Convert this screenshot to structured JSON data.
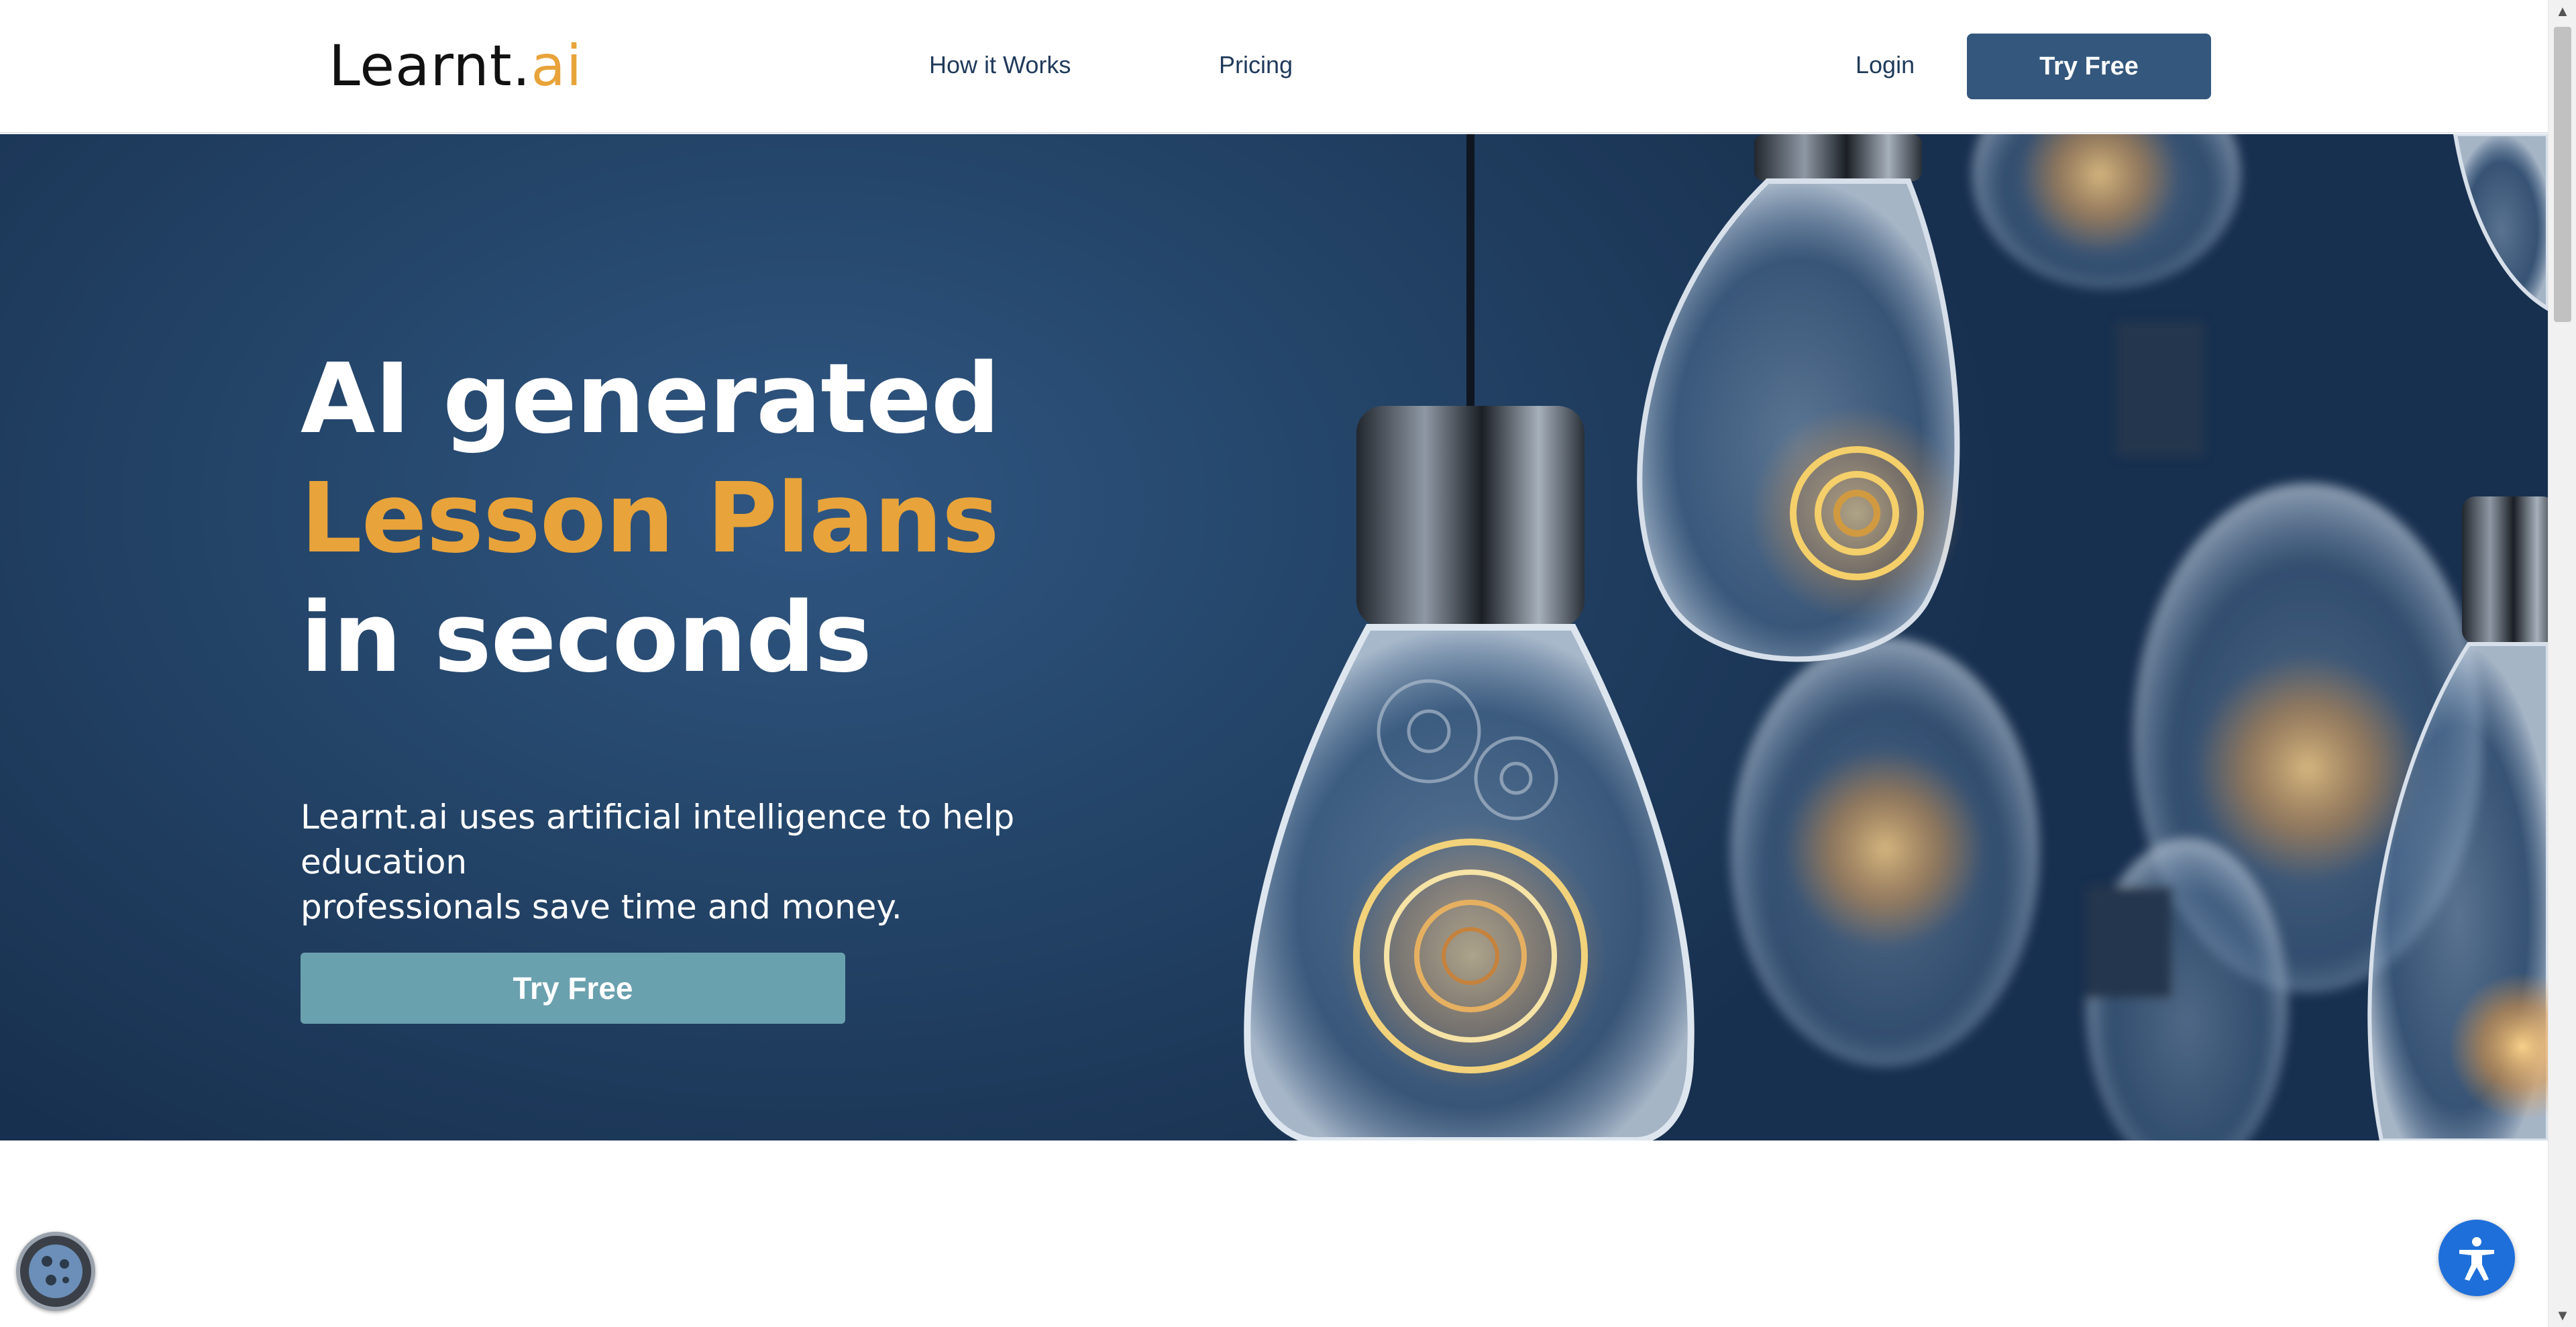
{
  "header": {
    "logo_text_main": "Learnt.",
    "logo_text_accent": "ai",
    "nav": {
      "how_it_works": "How it Works",
      "pricing": "Pricing",
      "login": "Login",
      "try_free": "Try Free"
    }
  },
  "hero": {
    "title_line1": "AI generated",
    "title_line2": "Lesson Plans",
    "title_line3": "in seconds",
    "subtitle_line1": "Learnt.ai uses artificial intelligence to help education",
    "subtitle_line2": "professionals save time and money.",
    "cta": "Try Free",
    "image_icon": "lightbulb-gears-image"
  },
  "widgets": {
    "cookie_icon": "cookie-icon",
    "accessibility_icon": "accessibility-icon"
  },
  "colors": {
    "brand_dark": "#34587d",
    "brand_accent": "#e8a33a",
    "hero_bg": "#244569",
    "cta_teal": "#6aa1ae",
    "accessibility_blue": "#1e6fd9"
  }
}
